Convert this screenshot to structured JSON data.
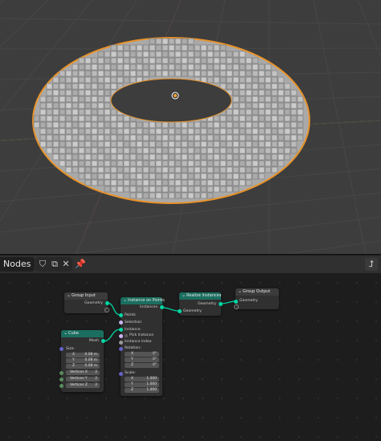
{
  "viewport": {
    "scene": "voxel-torus-of-cubes",
    "selection_outline_color": "#e8932b",
    "background": "#3d3d3d"
  },
  "header": {
    "editor_label": "Nodes"
  },
  "colors": {
    "geometry_socket": "#00d6a3",
    "node_header_geometry": "#1b6e5f",
    "link": "#00d6a3"
  },
  "nodes": {
    "group_input": {
      "title": "Group Input",
      "out_geometry": "Geometry"
    },
    "cube": {
      "title": "Cube",
      "out_mesh": "Mesh",
      "size_label": "Size:",
      "size": [
        {
          "axis": "X",
          "value": "0.08 m"
        },
        {
          "axis": "Y",
          "value": "0.08 m"
        },
        {
          "axis": "Z",
          "value": "0.08 m"
        }
      ],
      "vertices": [
        {
          "label": "Vertices X",
          "value": "2"
        },
        {
          "label": "Vertices Y",
          "value": "2"
        },
        {
          "label": "Vertices Z",
          "value": "2"
        }
      ]
    },
    "instance_on_points": {
      "title": "Instance on Points",
      "out_instances": "Instances",
      "in_points": "Points",
      "in_selection": "Selection",
      "in_instance": "Instance",
      "pick_instance": "Pick Instance",
      "instance_index": "Instance Index",
      "rotation_label": "Rotation:",
      "rotation": [
        {
          "axis": "X",
          "value": "0°"
        },
        {
          "axis": "Y",
          "value": "0°"
        },
        {
          "axis": "Z",
          "value": "0°"
        }
      ],
      "scale_label": "Scale:",
      "scale": [
        {
          "axis": "X",
          "value": "1.000"
        },
        {
          "axis": "Y",
          "value": "1.000"
        },
        {
          "axis": "Z",
          "value": "1.000"
        }
      ]
    },
    "realize_instances": {
      "title": "Realize Instances",
      "out_geometry": "Geometry",
      "in_geometry": "Geometry"
    },
    "group_output": {
      "title": "Group Output",
      "in_geometry": "Geometry"
    }
  }
}
